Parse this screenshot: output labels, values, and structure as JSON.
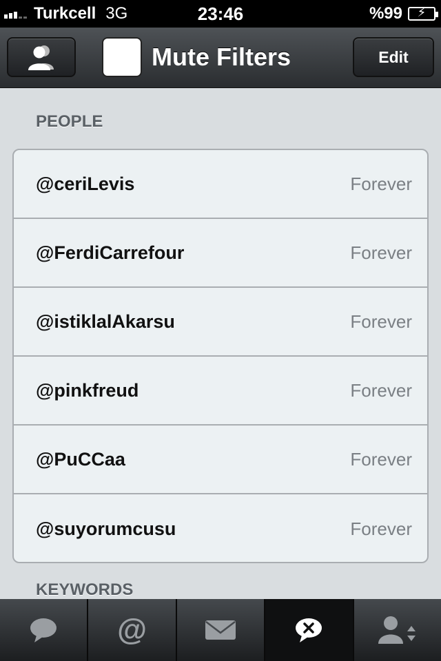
{
  "status_bar": {
    "carrier": "Turkcell",
    "network": "3G",
    "time": "23:46",
    "battery": "%99"
  },
  "nav_bar": {
    "title": "Mute Filters",
    "edit_label": "Edit"
  },
  "sections": {
    "people_title": "PEOPLE",
    "keywords_title": "KEYWORDS"
  },
  "people": [
    {
      "handle": "@ceriLevis",
      "duration": "Forever"
    },
    {
      "handle": "@FerdiCarrefour",
      "duration": "Forever"
    },
    {
      "handle": "@istiklalAkarsu",
      "duration": "Forever"
    },
    {
      "handle": "@pinkfreud",
      "duration": "Forever"
    },
    {
      "handle": "@PuCCaa",
      "duration": "Forever"
    },
    {
      "handle": "@suyorumcusu",
      "duration": "Forever"
    }
  ],
  "tab_bar": {
    "tabs": [
      {
        "icon": "speech-bubble-icon",
        "active": false
      },
      {
        "icon": "at-sign-icon",
        "active": false
      },
      {
        "icon": "envelope-icon",
        "active": false
      },
      {
        "icon": "mute-bubble-icon",
        "active": true
      },
      {
        "icon": "user-switch-icon",
        "active": false
      }
    ]
  }
}
